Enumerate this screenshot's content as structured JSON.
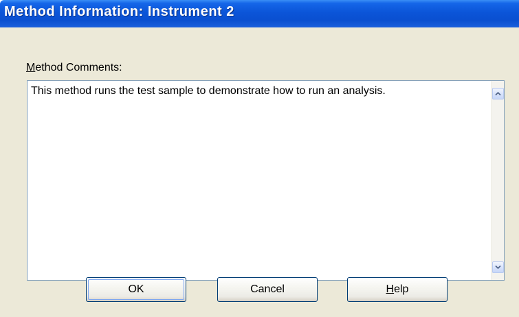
{
  "window": {
    "title": "Method Information: Instrument 2"
  },
  "comments": {
    "label_prefix": "M",
    "label_rest": "ethod Comments:",
    "text": "This method runs the test sample to demonstrate how to run an analysis."
  },
  "buttons": {
    "ok": "OK",
    "cancel": "Cancel",
    "help_prefix": "H",
    "help_rest": "elp"
  },
  "icons": {
    "scroll_up": "chevron-up-icon",
    "scroll_down": "chevron-down-icon"
  },
  "colors": {
    "titlebar": "#0b55d8",
    "dialog_background": "#ece9d8",
    "button_border": "#003c74"
  }
}
